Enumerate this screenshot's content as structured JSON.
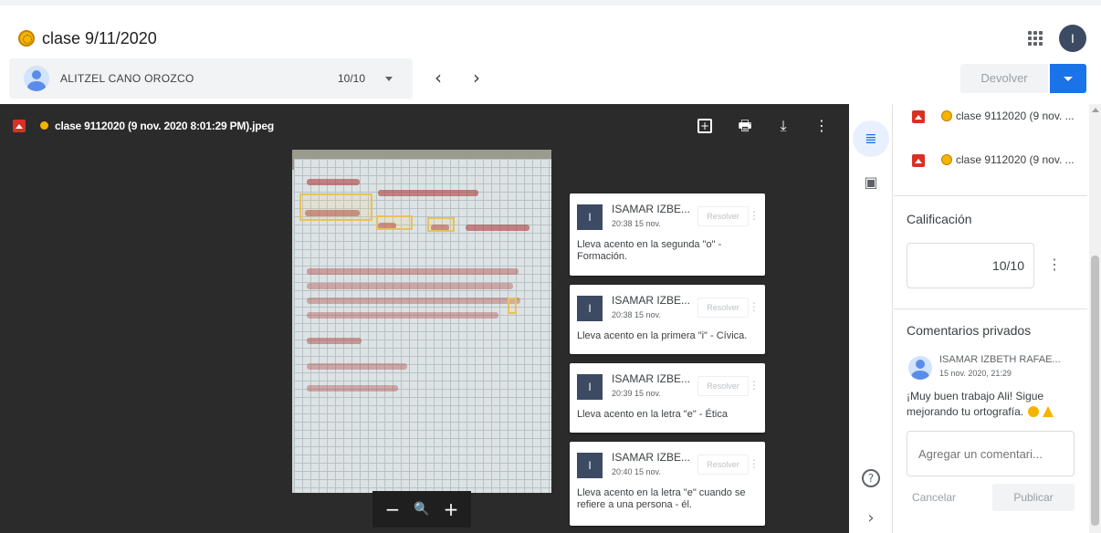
{
  "header": {
    "title": "clase 9/11/2020",
    "user_initial": "I",
    "apps_icon": "apps-grid-icon"
  },
  "student": {
    "name": "ALITZEL CANO OROZCO",
    "grade": "10/10",
    "prev_icon": "‹",
    "next_icon": "›"
  },
  "actions": {
    "return_label": "Devolver"
  },
  "viewer": {
    "file_name": "clase 9112020 (9 nov. 2020 8:01:29 PM).jpeg",
    "zoom_out": "−",
    "zoom_icon": "🔍",
    "zoom_in": "+"
  },
  "comments": [
    {
      "initial": "I",
      "author": "ISAMAR IZBE...",
      "time": "20:38 15 nov.",
      "resolve": "Resolver",
      "text": "Lleva acento en la segunda \"o\" - Formación."
    },
    {
      "initial": "I",
      "author": "ISAMAR IZBE...",
      "time": "20:38 15 nov.",
      "resolve": "Resolver",
      "text": "Lleva acento en la primera \"i\" - Cívica."
    },
    {
      "initial": "I",
      "author": "ISAMAR IZBE...",
      "time": "20:39 15 nov.",
      "resolve": "Resolver",
      "text": "Lleva acento en la letra \"e\" - Ética"
    },
    {
      "initial": "I",
      "author": "ISAMAR IZBE...",
      "time": "20:40 15 nov.",
      "resolve": "Resolver",
      "text": "Lleva acento en la letra \"e\" cuando se refiere a una persona - él."
    }
  ],
  "sidebar": {
    "attachments": [
      {
        "name": "clase 9112020 (9 nov. ..."
      },
      {
        "name": "clase 9112020 (9 nov. ..."
      }
    ],
    "grade_label": "Calificación",
    "grade_value": "10/10",
    "private_comments_label": "Comentarios privados",
    "private_comment": {
      "author": "ISAMAR IZBETH RAFAE...",
      "time": "15 nov. 2020, 21:29",
      "text": "¡Muy buen trabajo Ali! Sigue mejorando tu ortografía."
    },
    "add_comment_placeholder": "Agregar un comentari...",
    "cancel_label": "Cancelar",
    "publish_label": "Publicar"
  },
  "colors": {
    "accent": "#1a73e8",
    "viewer_bg": "#2b2b2b",
    "highlight": "#e8c15c",
    "class_icon": "#f5b400",
    "image_icon": "#d93025"
  }
}
